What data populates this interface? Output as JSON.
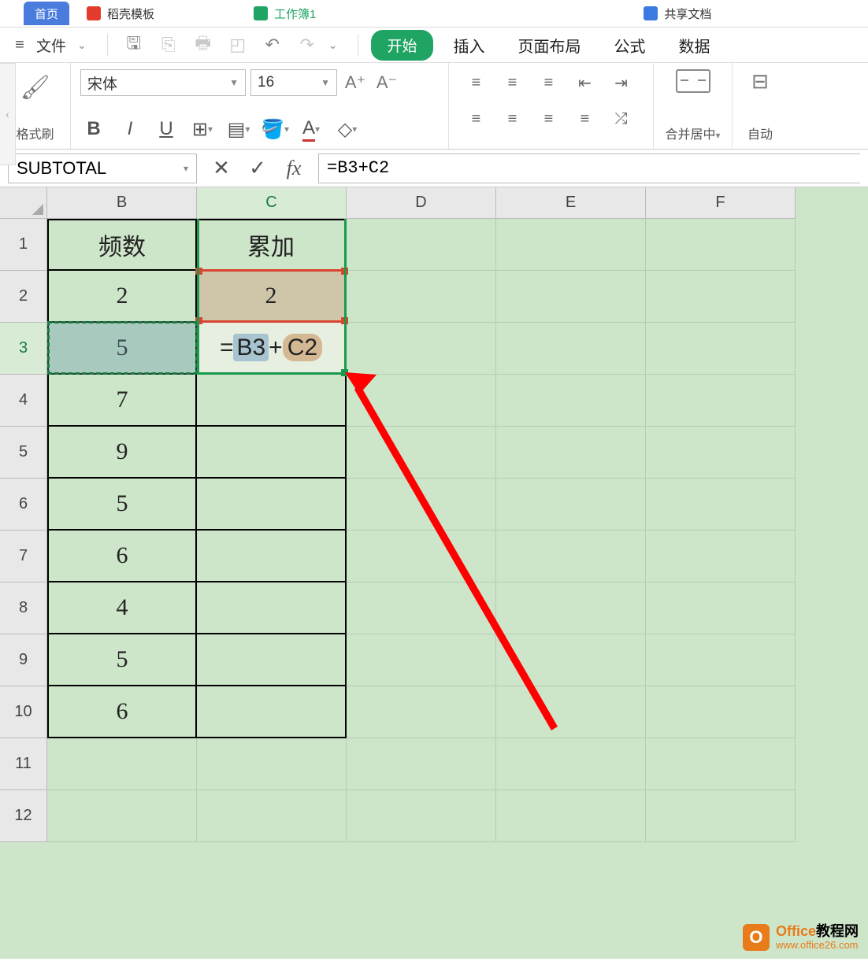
{
  "tabs": {
    "first": "首页",
    "second": "稻壳模板",
    "third": "工作簿1",
    "fourth": "共享文档"
  },
  "file_menu": "文件",
  "ribbon": {
    "start": "开始",
    "insert": "插入",
    "layout": "页面布局",
    "formula": "公式",
    "data": "数据"
  },
  "toolbar": {
    "format_painter": "格式刷",
    "font_name": "宋体",
    "font_size": "16",
    "merge": "合并居中",
    "auto": "自动"
  },
  "namebox": "SUBTOTAL",
  "formula_bar": "=B3+C2",
  "columns": [
    "B",
    "C",
    "D",
    "E",
    "F"
  ],
  "rows": [
    "1",
    "2",
    "3",
    "4",
    "5",
    "6",
    "7",
    "8",
    "9",
    "10",
    "11",
    "12"
  ],
  "headers": {
    "B": "频数",
    "C": "累加"
  },
  "dataB": [
    "2",
    "5",
    "7",
    "9",
    "5",
    "6",
    "4",
    "5",
    "6"
  ],
  "dataC2": "2",
  "inline_formula": {
    "eq": "=",
    "r1": "B3",
    "plus": "+",
    "r2": "C2"
  },
  "watermark": {
    "main1": "Office",
    "main2": "教程网",
    "sub": "www.office26.com"
  }
}
